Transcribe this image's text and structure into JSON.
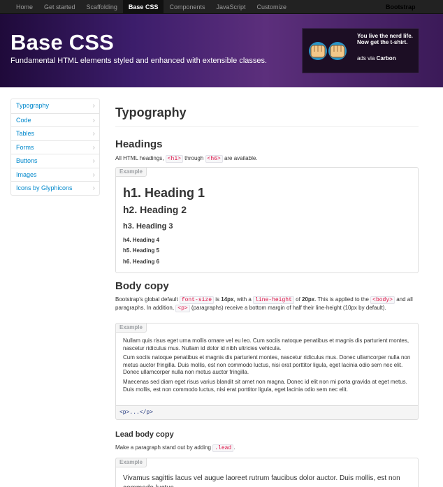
{
  "navbar": {
    "items": [
      {
        "label": "Home",
        "active": false
      },
      {
        "label": "Get started",
        "active": false
      },
      {
        "label": "Scaffolding",
        "active": false
      },
      {
        "label": "Base CSS",
        "active": true
      },
      {
        "label": "Components",
        "active": false
      },
      {
        "label": "JavaScript",
        "active": false
      },
      {
        "label": "Customize",
        "active": false
      }
    ],
    "brand": "Bootstrap"
  },
  "hero": {
    "title": "Base CSS",
    "subtitle": "Fundamental HTML elements styled and enhanced with extensible classes.",
    "ad": {
      "text": "You live the nerd life. Now get the t-shirt.",
      "via_prefix": "ads via ",
      "via_name": "Carbon"
    }
  },
  "sidebar": {
    "items": [
      {
        "label": "Typography"
      },
      {
        "label": "Code"
      },
      {
        "label": "Tables"
      },
      {
        "label": "Forms"
      },
      {
        "label": "Buttons"
      },
      {
        "label": "Images"
      },
      {
        "label": "Icons by Glyphicons"
      }
    ],
    "chevron": "›"
  },
  "main": {
    "title": "Typography",
    "headings": {
      "title": "Headings",
      "desc_prefix": "All HTML headings, ",
      "code1": "<h1>",
      "desc_mid": " through ",
      "code2": "<h6>",
      "desc_suffix": " are available.",
      "example_label": "Example",
      "items": [
        "h1. Heading 1",
        "h2. Heading 2",
        "h3. Heading 3",
        "h4. Heading 4",
        "h5. Heading 5",
        "h6. Heading 6"
      ]
    },
    "body_copy": {
      "title": "Body copy",
      "desc_1": "Bootstrap's global default ",
      "code_font_size": "font-size",
      "desc_2": " is ",
      "bold_14": "14px",
      "desc_3": ", with a ",
      "code_line_height": "line-height",
      "desc_4": " of ",
      "bold_20": "20px",
      "desc_5": ". This is applied to the ",
      "code_body": "<body>",
      "desc_6": " and all paragraphs. In addition, ",
      "code_p": "<p>",
      "desc_7": " (paragraphs) receive a bottom margin of half their line-height (10px by default).",
      "example_label": "Example",
      "paragraphs": [
        "Nullam quis risus eget urna mollis ornare vel eu leo. Cum sociis natoque penatibus et magnis dis parturient montes, nascetur ridiculus mus. Nullam id dolor id nibh ultricies vehicula.",
        "Cum sociis natoque penatibus et magnis dis parturient montes, nascetur ridiculus mus. Donec ullamcorper nulla non metus auctor fringilla. Duis mollis, est non commodo luctus, nisi erat porttitor ligula, eget lacinia odio sem nec elit. Donec ullamcorper nulla non metus auctor fringilla.",
        "Maecenas sed diam eget risus varius blandit sit amet non magna. Donec id elit non mi porta gravida at eget metus. Duis mollis, est non commodo luctus, nisi erat porttitor ligula, eget lacinia odio sem nec elit."
      ],
      "code_sample": "<p>...</p>"
    },
    "lead": {
      "title": "Lead body copy",
      "desc_prefix": "Make a paragraph stand out by adding ",
      "code": ".lead",
      "desc_suffix": ".",
      "example_label": "Example",
      "text": "Vivamus sagittis lacus vel augue laoreet rutrum faucibus dolor auctor. Duis mollis, est non commodo luctus."
    }
  }
}
